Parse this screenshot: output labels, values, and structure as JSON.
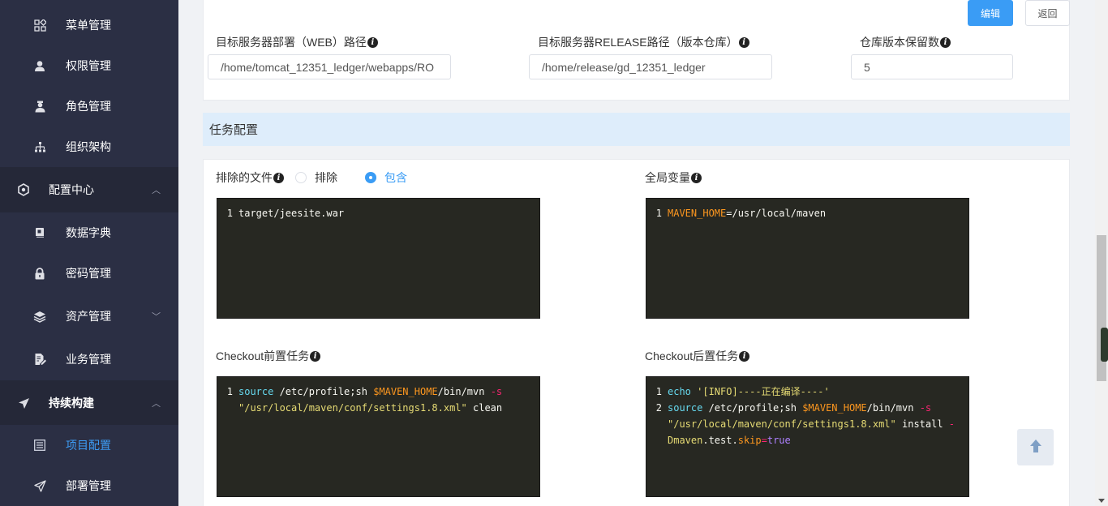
{
  "sidebar": {
    "items": [
      {
        "label": "菜单管理",
        "icon": "grid-icon"
      },
      {
        "label": "权限管理",
        "icon": "user-key-icon"
      },
      {
        "label": "角色管理",
        "icon": "role-icon"
      },
      {
        "label": "组织架构",
        "icon": "org-tree-icon"
      },
      {
        "label": "配置中心",
        "icon": "hexagon-gear-icon"
      },
      {
        "label": "数据字典",
        "icon": "dictionary-icon"
      },
      {
        "label": "密码管理",
        "icon": "lock-icon"
      },
      {
        "label": "资产管理",
        "icon": "layers-icon"
      },
      {
        "label": "业务管理",
        "icon": "document-edit-icon"
      },
      {
        "label": "持续构建",
        "icon": "paper-plane-icon"
      },
      {
        "label": "项目配置",
        "icon": "list-icon"
      },
      {
        "label": "部署管理",
        "icon": "send-icon"
      }
    ]
  },
  "toolbar": {
    "edit_label": "编辑",
    "back_label": "返回"
  },
  "deploy": {
    "web_path_label": "目标服务器部署（WEB）路径",
    "web_path_value": "/home/tomcat_12351_ledger/webapps/RO",
    "release_path_label": "目标服务器RELEASE路径（版本仓库）",
    "release_path_value": "/home/release/gd_12351_ledger",
    "keep_label": "仓库版本保留数",
    "keep_value": "5"
  },
  "task_section": {
    "title": "任务配置"
  },
  "files": {
    "label": "排除的文件",
    "option_exclude": "排除",
    "option_include": "包含",
    "selected": "包含",
    "lines": [
      {
        "n": "1",
        "code": "target/jeesite.war"
      }
    ]
  },
  "globals": {
    "label": "全局变量",
    "lines": [
      {
        "n": "1",
        "var": "MAVEN_HOME",
        "rest": "=/usr/local/maven"
      }
    ]
  },
  "pre_checkout": {
    "label": "Checkout前置任务",
    "l1_n": "1",
    "l1_kw": "source",
    "l1_a": " /etc/profile;sh ",
    "l1_var": "$MAVEN_HOME",
    "l1_b": "/bin/mvn ",
    "l1_flag": "-s",
    "l2_str": "\"/usr/local/maven/conf/settings1.8.xml\"",
    "l2_rest": " clean"
  },
  "post_checkout": {
    "label": "Checkout后置任务",
    "l1_n": "1",
    "l1_kw": "echo",
    "l1_str": " '[INFO]----正在编译----'",
    "l2_n": "2",
    "l2_kw": "source",
    "l2_a": " /etc/profile;sh ",
    "l2_var": "$MAVEN_HOME",
    "l2_b": "/bin/mvn ",
    "l2_flag": "-s",
    "l3_str": "\"/usr/local/maven/conf/settings1.8.xml\"",
    "l3_rest": " install ",
    "l3_flag": "-",
    "l4_a": "Dmaven",
    "l4_b": ".test.",
    "l4_c": "skip",
    "l4_eq": "=",
    "l4_val": "true"
  },
  "info_glyph": "i",
  "colors": {
    "accent": "#3a9cf5",
    "sidebar_bg": "#2b2f44",
    "editor_bg": "#272822"
  }
}
